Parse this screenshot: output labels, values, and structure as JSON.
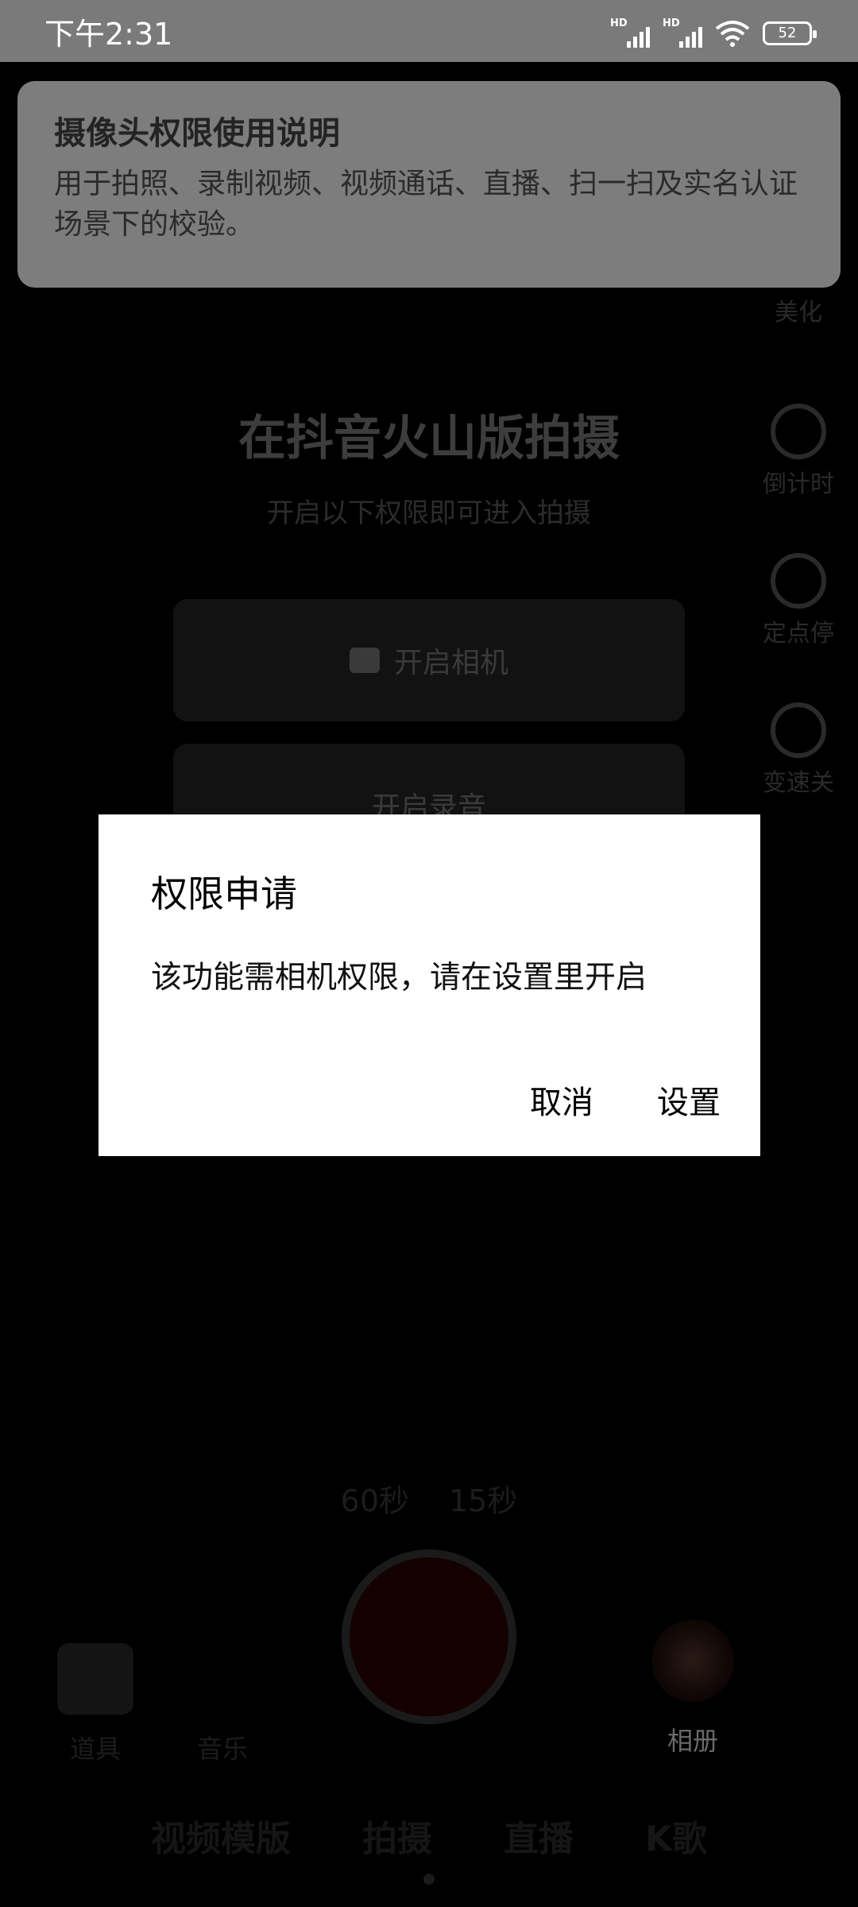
{
  "status_bar": {
    "time": "下午2:31",
    "sim1_label": "HD",
    "sim2_label": "HD",
    "battery": "52"
  },
  "notice": {
    "title": "摄像头权限使用说明",
    "body": "用于拍照、录制视频、视频通话、直播、扫一扫及实名认证场景下的校验。"
  },
  "camera_page": {
    "rail": [
      {
        "label": "美化",
        "icon": "beautify-icon"
      },
      {
        "label": "倒计时",
        "icon": "timer-icon"
      },
      {
        "label": "定点停",
        "icon": "pause-point-icon"
      },
      {
        "label": "变速关",
        "icon": "speed-off-icon"
      }
    ],
    "title": "在抖音火山版拍摄",
    "subtitle": "开启以下权限即可进入拍摄",
    "open_camera": "开启相机",
    "open_mic": "开启录音",
    "durations": [
      "60秒",
      "15秒"
    ],
    "props_label": "道具",
    "music_label": "音乐",
    "album_label": "相册",
    "tabs": [
      "视频模版",
      "拍摄",
      "直播",
      "K歌"
    ]
  },
  "dialog": {
    "title": "权限申请",
    "message": "该功能需相机权限，请在设置里开启",
    "cancel": "取消",
    "settings": "设置"
  },
  "colors": {
    "overlay_banner": "#7d7d7d",
    "dialog_bg": "#ffffff",
    "screen_bg": "#000000"
  }
}
